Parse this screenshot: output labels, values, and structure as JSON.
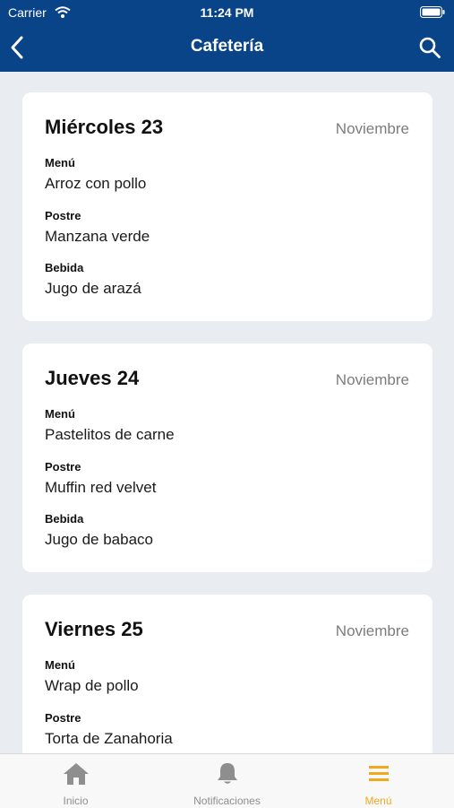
{
  "status": {
    "carrier": "Carrier",
    "time": "11:24 PM"
  },
  "navbar": {
    "title": "Cafetería"
  },
  "days": [
    {
      "day": "Miércoles 23",
      "month": "Noviembre",
      "menu_label": "Menú",
      "menu": "Arroz con pollo",
      "postre_label": "Postre",
      "postre": "Manzana verde",
      "bebida_label": "Bebida",
      "bebida": "Jugo de arazá"
    },
    {
      "day": "Jueves 24",
      "month": "Noviembre",
      "menu_label": "Menú",
      "menu": "Pastelitos de carne",
      "postre_label": "Postre",
      "postre": "Muffin red velvet",
      "bebida_label": "Bebida",
      "bebida": "Jugo de babaco"
    },
    {
      "day": "Viernes 25",
      "month": "Noviembre",
      "menu_label": "Menú",
      "menu": "Wrap de pollo",
      "postre_label": "Postre",
      "postre": "Torta de Zanahoria",
      "bebida_label": "",
      "bebida": ""
    }
  ],
  "tabs": [
    {
      "label": "Inicio",
      "icon": "home-icon"
    },
    {
      "label": "Notificaciones",
      "icon": "bell-icon"
    },
    {
      "label": "Menú",
      "icon": "menu-icon",
      "active": true
    }
  ],
  "colors": {
    "brand": "#0a4488",
    "accent": "#f0a81c",
    "background": "#e9edf1"
  }
}
